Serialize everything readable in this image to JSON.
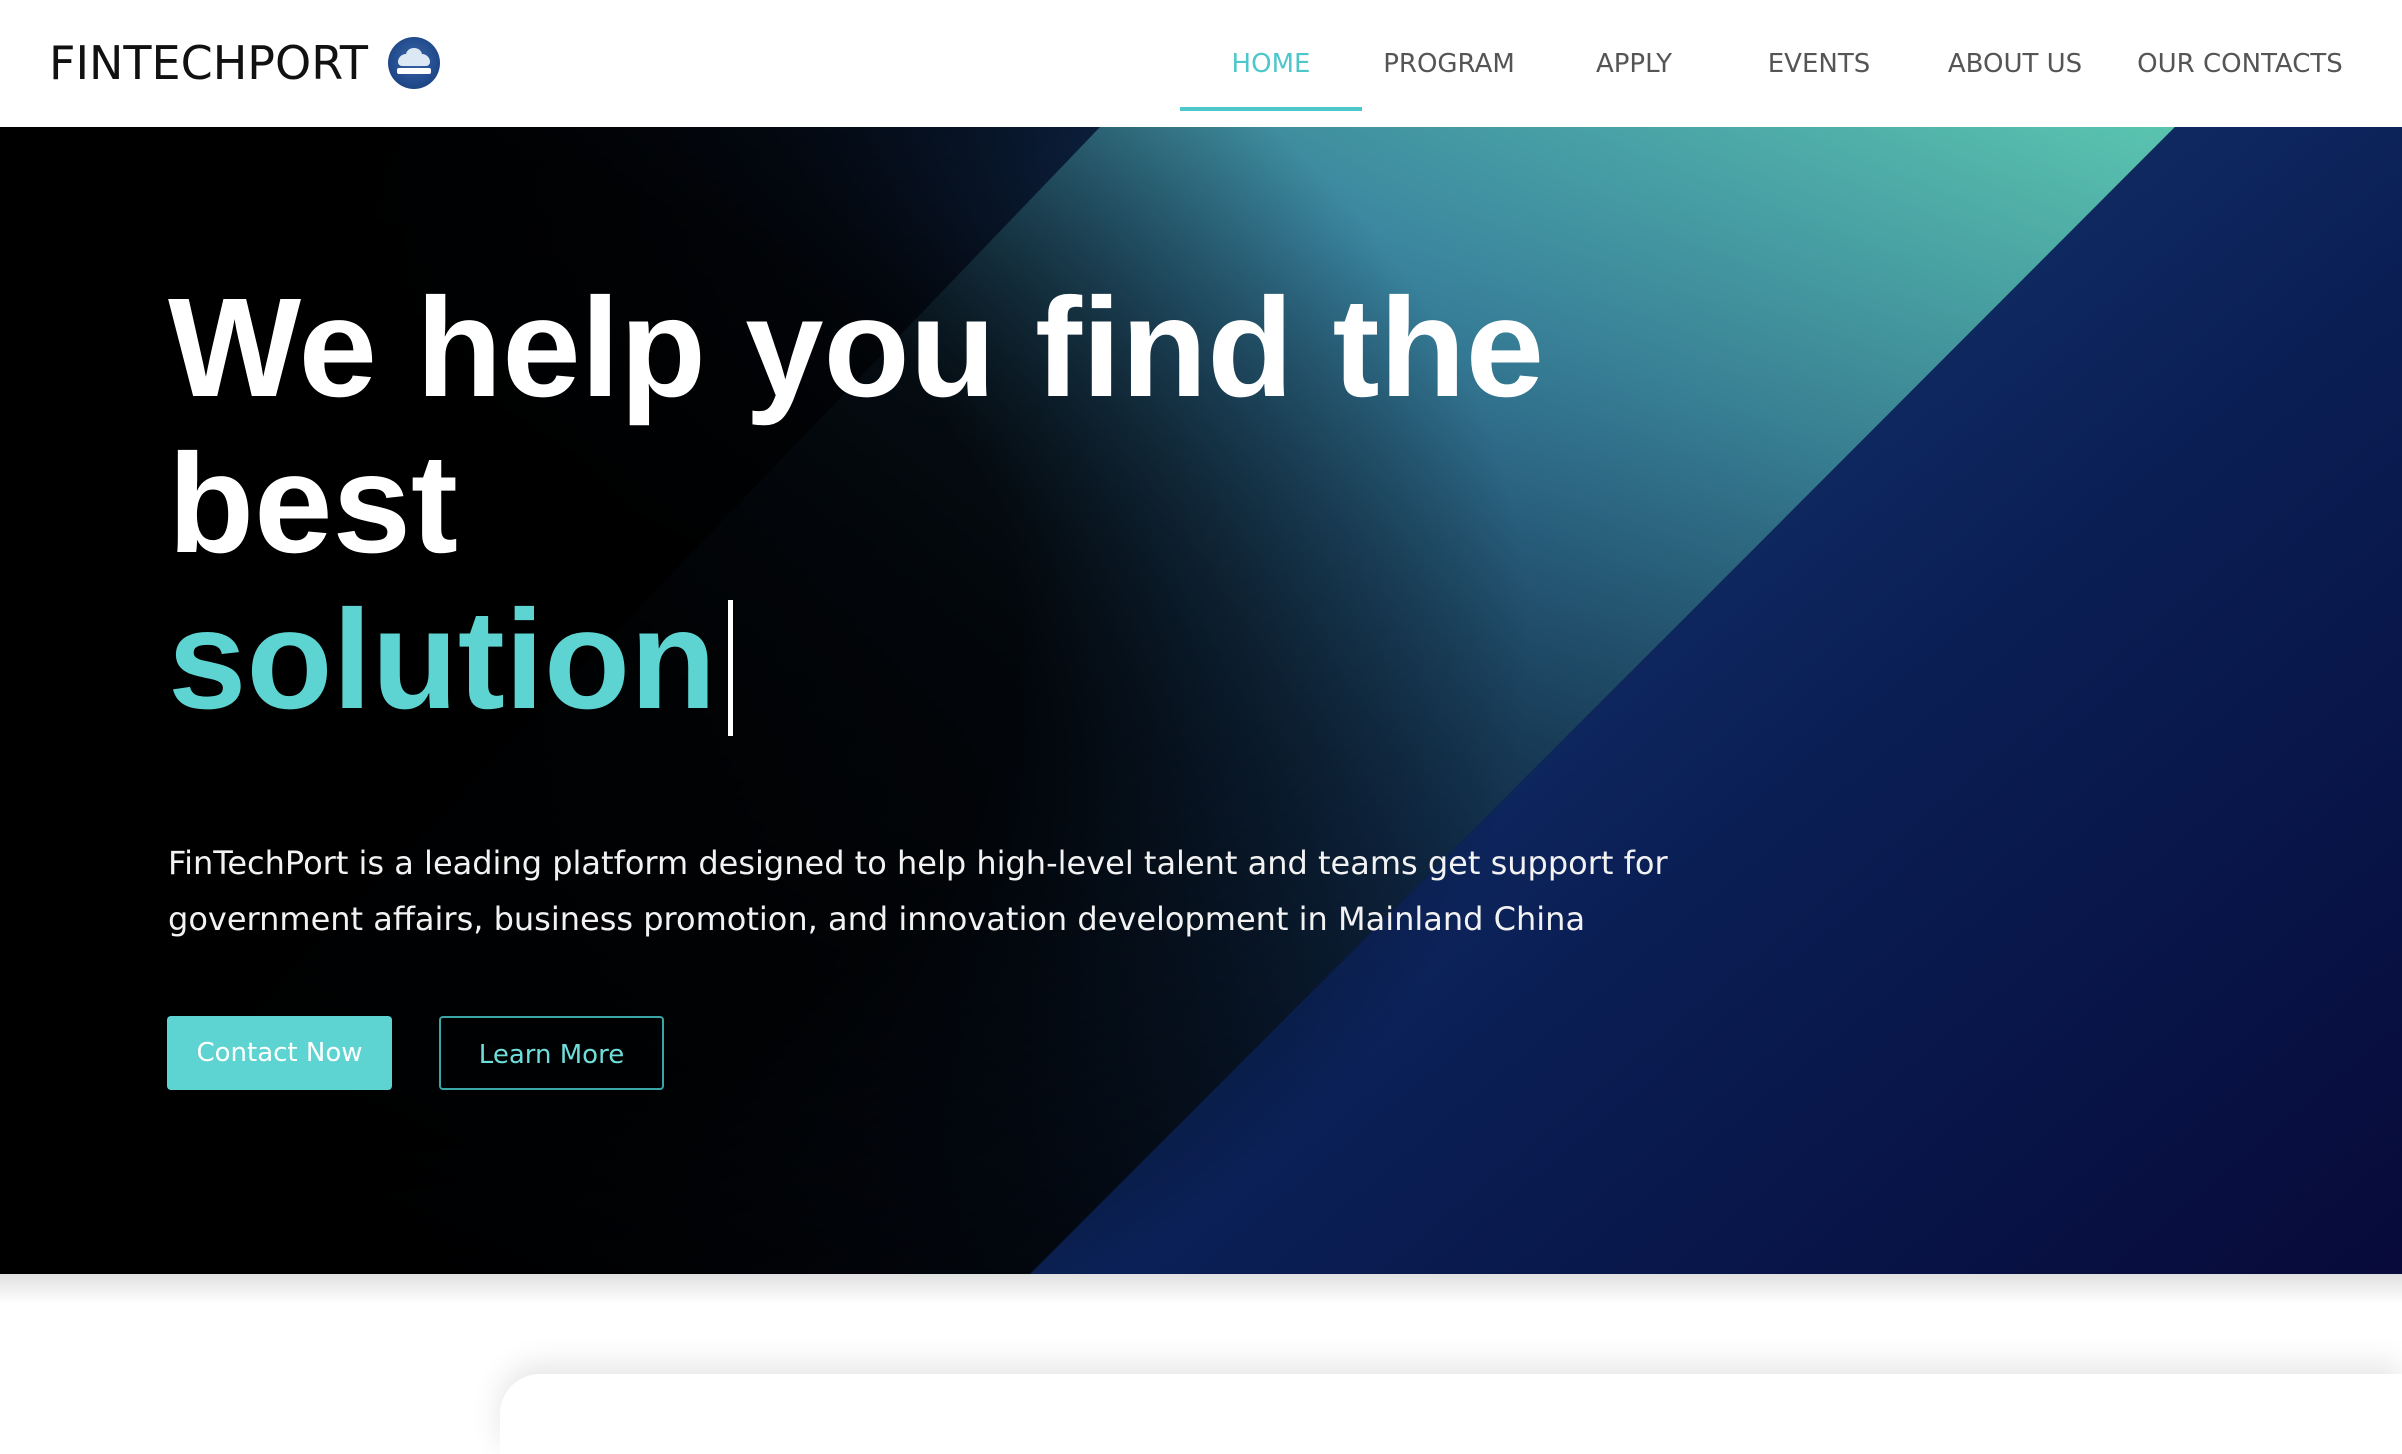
{
  "brand": {
    "name": "FINTECHPORT",
    "logo_icon": "fintechport-globe-logo"
  },
  "nav": {
    "items": [
      {
        "label": "HOME",
        "active": true
      },
      {
        "label": "PROGRAM",
        "active": false
      },
      {
        "label": "APPLY",
        "active": false
      },
      {
        "label": "EVENTS",
        "active": false
      },
      {
        "label": "ABOUT US",
        "active": false
      },
      {
        "label": "OUR CONTACTS",
        "active": false
      }
    ]
  },
  "hero": {
    "title": "We help you find the best",
    "accent": "solution",
    "description": "FinTechPort is a leading platform designed to help high-level talent and teams get support for government affairs, business promotion, and innovation development in Mainland China",
    "primary_button": "Contact Now",
    "secondary_button": "Learn More"
  },
  "colors": {
    "accent": "#5dd4d1",
    "nav_active": "#4ec7cb",
    "hero_background": "#000000",
    "hero_blue": "#1f4a86",
    "hero_teal": "#64e0cb"
  }
}
